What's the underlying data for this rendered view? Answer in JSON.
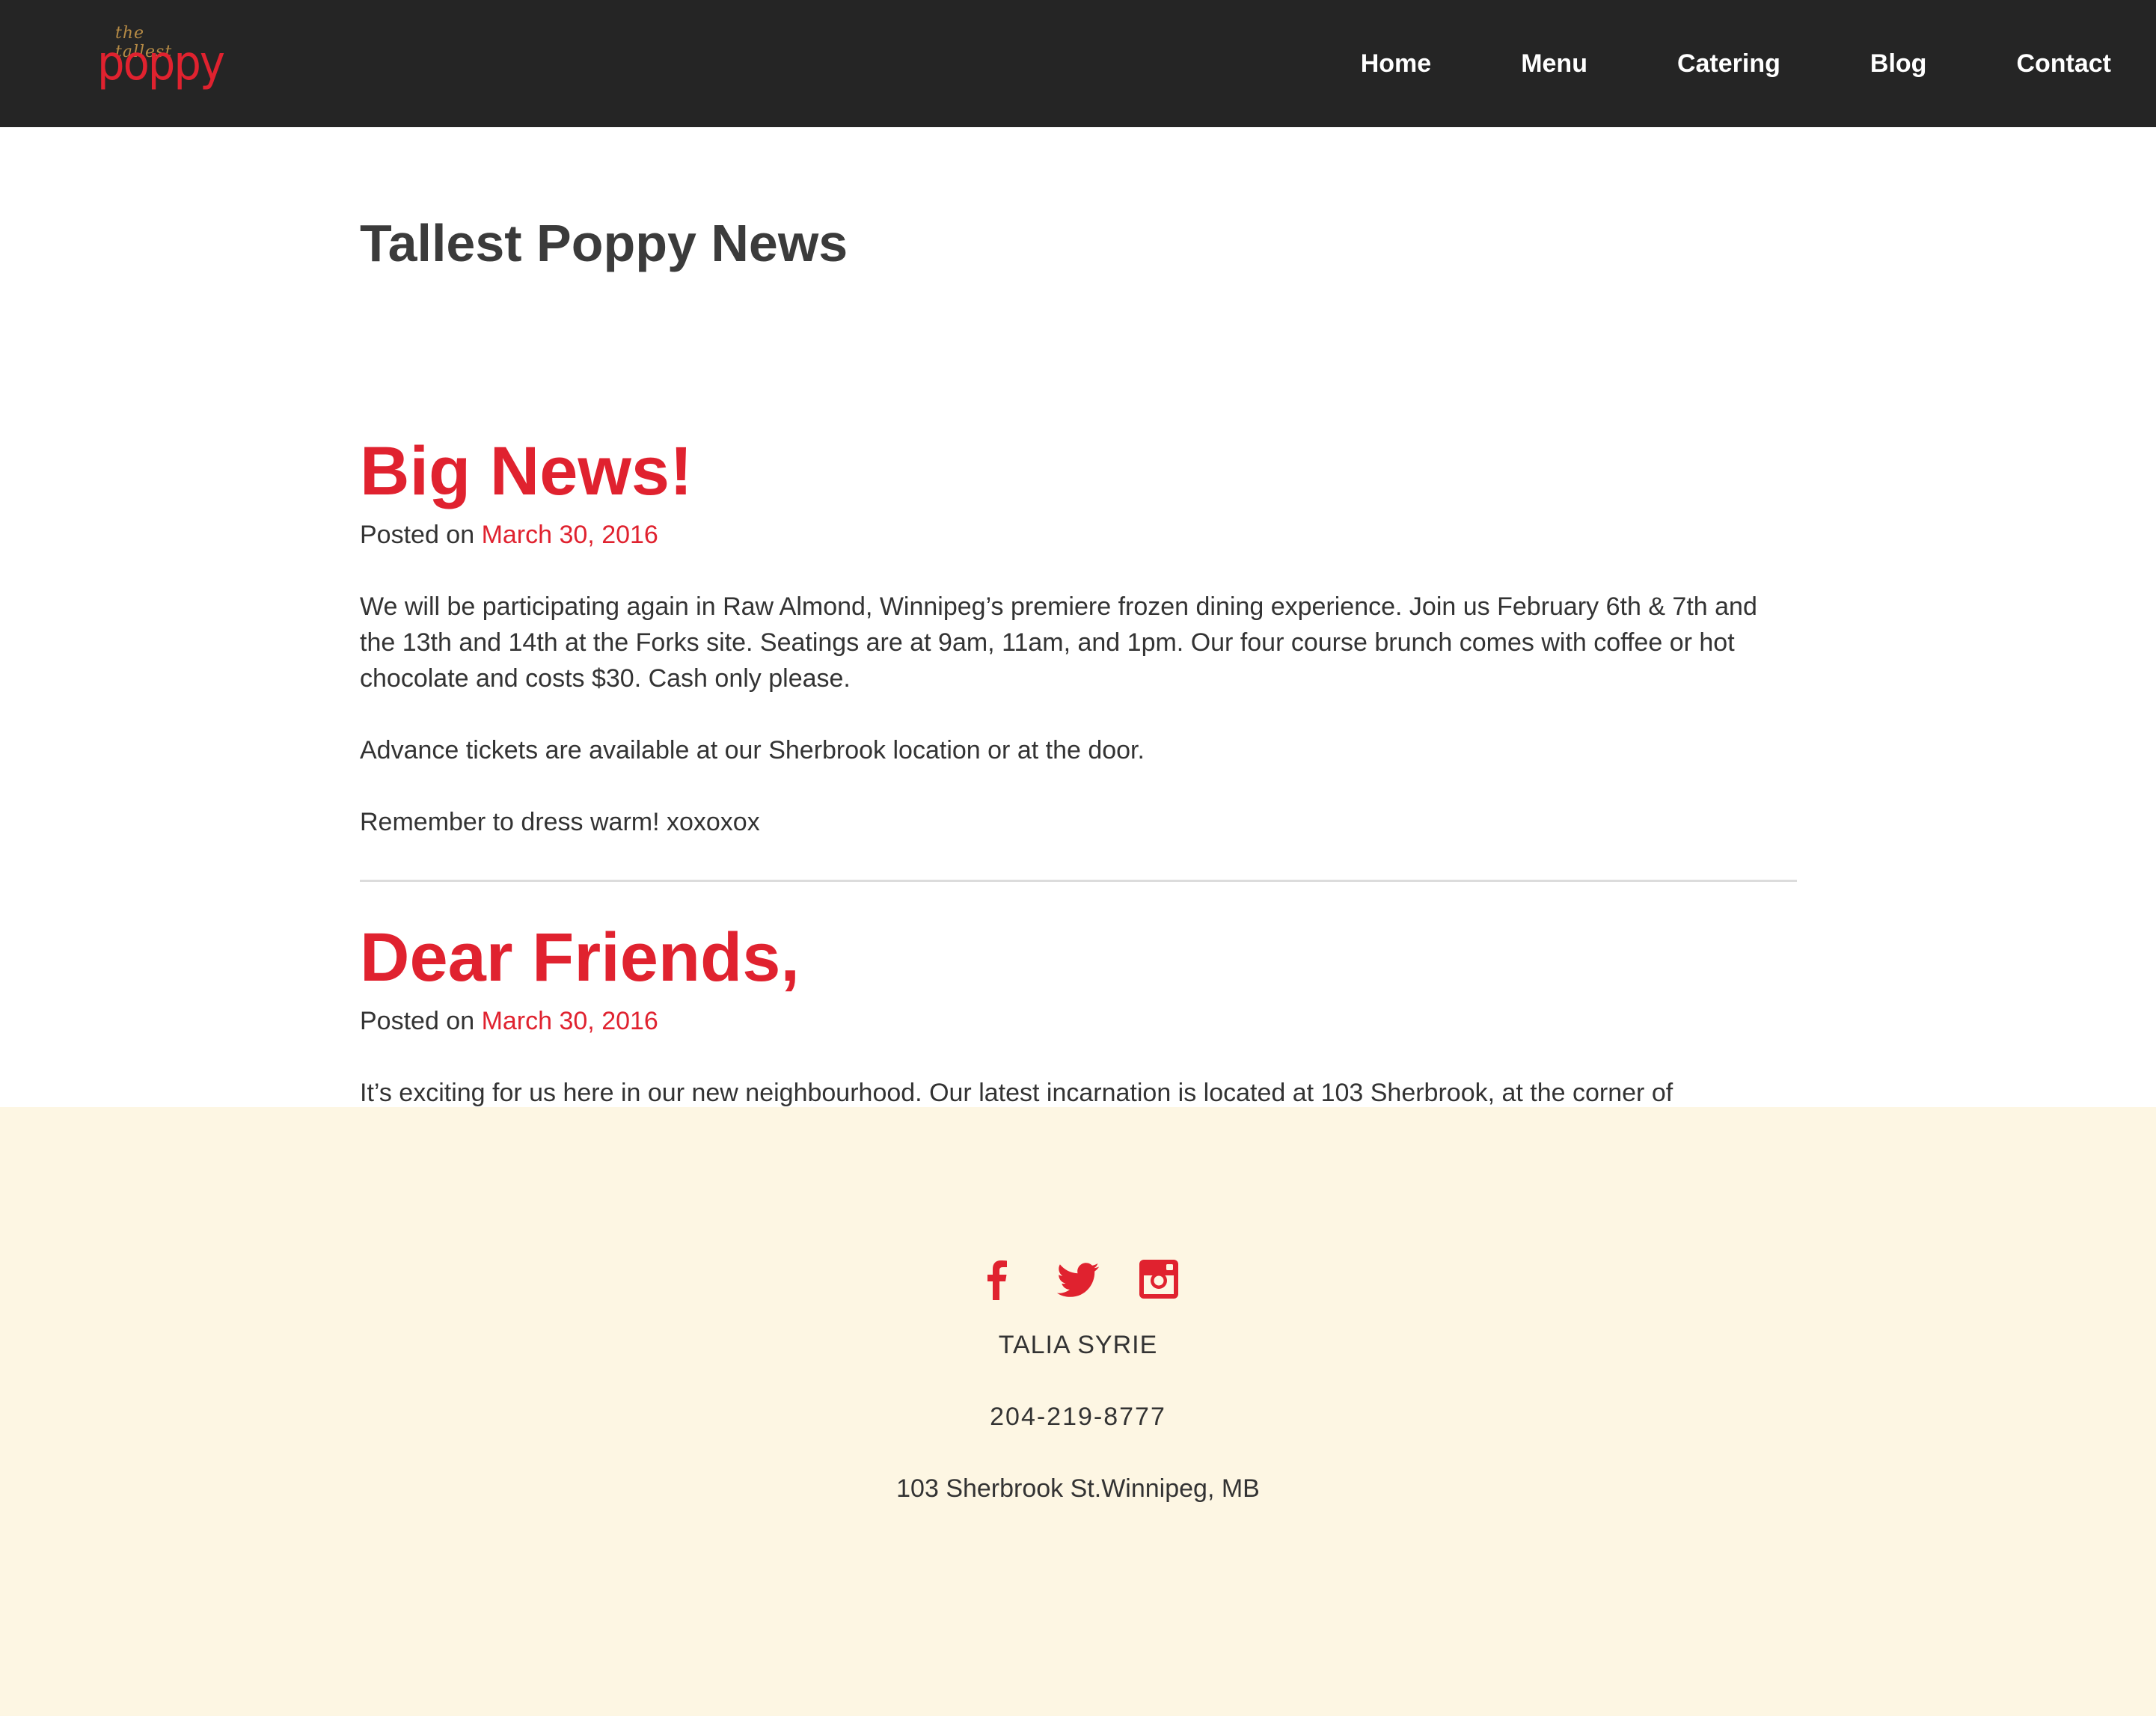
{
  "colors": {
    "accent": "#e0222f",
    "header_bg": "#252525",
    "footer_bg": "#fdf6e3",
    "text": "#333333",
    "divider": "#dcdcdc"
  },
  "header": {
    "logo": {
      "small_text": "the tallest",
      "big_text": "poppy"
    },
    "nav": [
      "Home",
      "Menu",
      "Catering",
      "Blog",
      "Contact"
    ]
  },
  "main": {
    "page_title": "Tallest Poppy News",
    "posts": [
      {
        "title": "Big News!",
        "posted_label": "Posted on",
        "date": "March 30, 2016",
        "paragraphs": [
          "We will be participating again in Raw Almond, Winnipeg’s premiere frozen dining experience. Join us February 6th & 7th and the 13th and 14th at the Forks site. Seatings are at 9am, 11am, and 1pm. Our four course brunch comes with coffee or hot chocolate and costs $30. Cash only please.",
          "Advance tickets are available at our Sherbrook location or at the door.",
          "Remember to dress warm! xoxoxox"
        ]
      },
      {
        "title": "Dear Friends,",
        "posted_label": "Posted on",
        "date": "March 30, 2016",
        "paragraphs": [
          "It’s exciting for us here in our new neighbourhood. Our latest incarnation is located at 103 Sherbrook, at the corner of Sherbrook and Westminster at the front of the Sherbrook Inn. Some things have changed since we came here."
        ]
      }
    ]
  },
  "footer": {
    "social_icons": [
      "facebook-icon",
      "twitter-icon",
      "instagram-icon"
    ],
    "name": "TALIA SYRIE",
    "phone": "204-219-8777",
    "address": "103 Sherbrook St.Winnipeg, MB"
  }
}
